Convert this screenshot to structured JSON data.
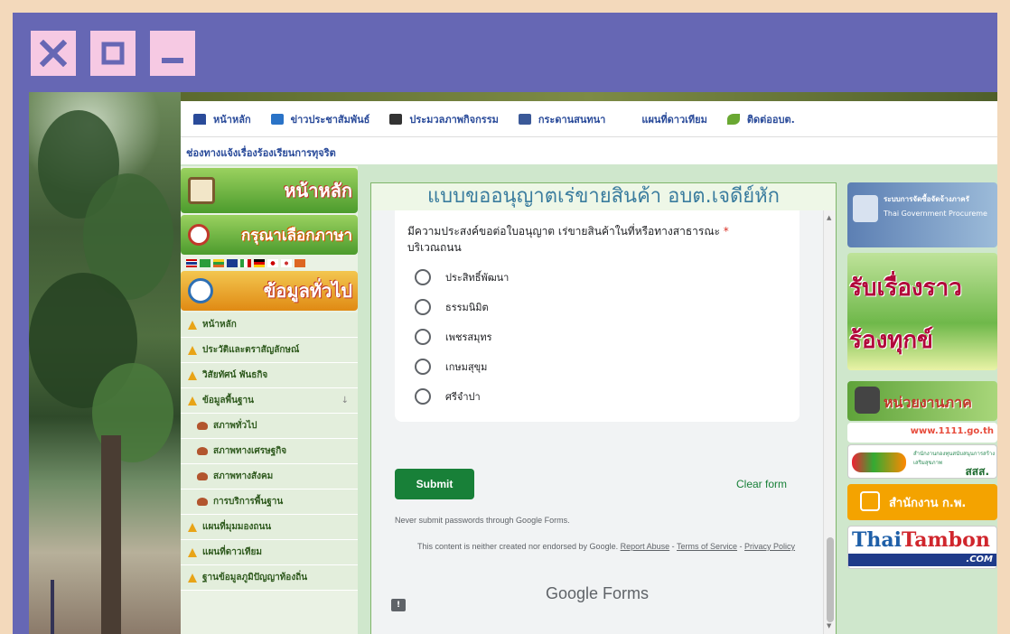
{
  "window_controls": {
    "close_icon": "close-icon",
    "maximize_icon": "maximize-icon",
    "minimize_icon": "minimize-icon"
  },
  "menu": {
    "items": [
      {
        "label": "หน้าหลัก",
        "icon": "home-icon",
        "color": "#2a4b9a"
      },
      {
        "label": "ข่าวประชาสัมพันธ์",
        "icon": "megaphone-icon",
        "color": "#2a73c7"
      },
      {
        "label": "ประมวลภาพกิจกรรม",
        "icon": "camera-icon",
        "color": "#333333"
      },
      {
        "label": "กระดานสนทนา",
        "icon": "facebook-icon",
        "color": "#3b5998"
      },
      {
        "label": "แผนที่ดาวเทียม",
        "icon": "",
        "color": ""
      },
      {
        "label": "ติดต่ออบต.",
        "icon": "leaf-icon",
        "color": "#6aa832"
      }
    ],
    "second_row": "ช่องทางแจ้งเรื่องร้องเรียนการทุจริต"
  },
  "left": {
    "banner_home": "หน้าหลัก",
    "banner_language": "กรุณาเลือกภาษา",
    "banner_info": "ข้อมูลทั่วไป",
    "nav": [
      {
        "label": "หน้าหลัก",
        "type": "main"
      },
      {
        "label": "ประวัติและตราสัญลักษณ์",
        "type": "main"
      },
      {
        "label": "วิสัยทัศน์ พันธกิจ",
        "type": "main"
      },
      {
        "label": "ข้อมูลพื้นฐาน",
        "type": "main",
        "arrow": "↓"
      },
      {
        "label": "สภาพทั่วไป",
        "type": "sub"
      },
      {
        "label": "สภาพทางเศรษฐกิจ",
        "type": "sub"
      },
      {
        "label": "สภาพทางสังคม",
        "type": "sub"
      },
      {
        "label": "การบริการพื้นฐาน",
        "type": "sub"
      },
      {
        "label": "แผนที่มุมมองถนน",
        "type": "main"
      },
      {
        "label": "แผนที่ดาวเทียม",
        "type": "main"
      },
      {
        "label": "ฐานข้อมูลภูมิปัญญาท้องถิ่น",
        "type": "main"
      }
    ]
  },
  "form": {
    "title": "แบบขออนุญาตเร่ขายสินค้า อบต.เจดีย์หัก",
    "question": "มีความประสงค์ขอต่อใบอนุญาต เร่ขายสินค้าในที่หรือทางสาธารณะ",
    "question_line2": "บริเวณถนน",
    "required_mark": "*",
    "options": [
      "ประสิทธิ์พัฒนา",
      "ธรรมนิมิต",
      "เพชรสมุทร",
      "เกษมสุขุม",
      "ศรีจำปา"
    ],
    "submit_label": "Submit",
    "clear_label": "Clear form",
    "never_text": "Never submit passwords through Google Forms.",
    "disclaimer_prefix": "This content is neither created nor endorsed by Google.",
    "report_abuse": "Report Abuse",
    "terms": "Terms of Service",
    "privacy": "Privacy Policy",
    "brand_google": "Google",
    "brand_forms": "Forms",
    "accent": "#188038"
  },
  "right": {
    "procurement_title": "ระบบการจัดซื้อจัดจ้างภาครั",
    "procurement_sub": "Thai Government Procureme",
    "complaint_l1": "รับเรื่องราว",
    "complaint_l2": "ร้องทุกข์",
    "agency": "หน่วยงานภาค",
    "www": "www.1111.go.th",
    "sss_small": "สำนักงานกองทุนสนับสนุนการสร้างเสริมสุขภาพ",
    "sss": "สสส.",
    "ocsc": "สำนักงาน ก.พ.",
    "thaitambon_a": "Thai",
    "thaitambon_b": "Tambon",
    "thaitambon_com": ".COM"
  }
}
